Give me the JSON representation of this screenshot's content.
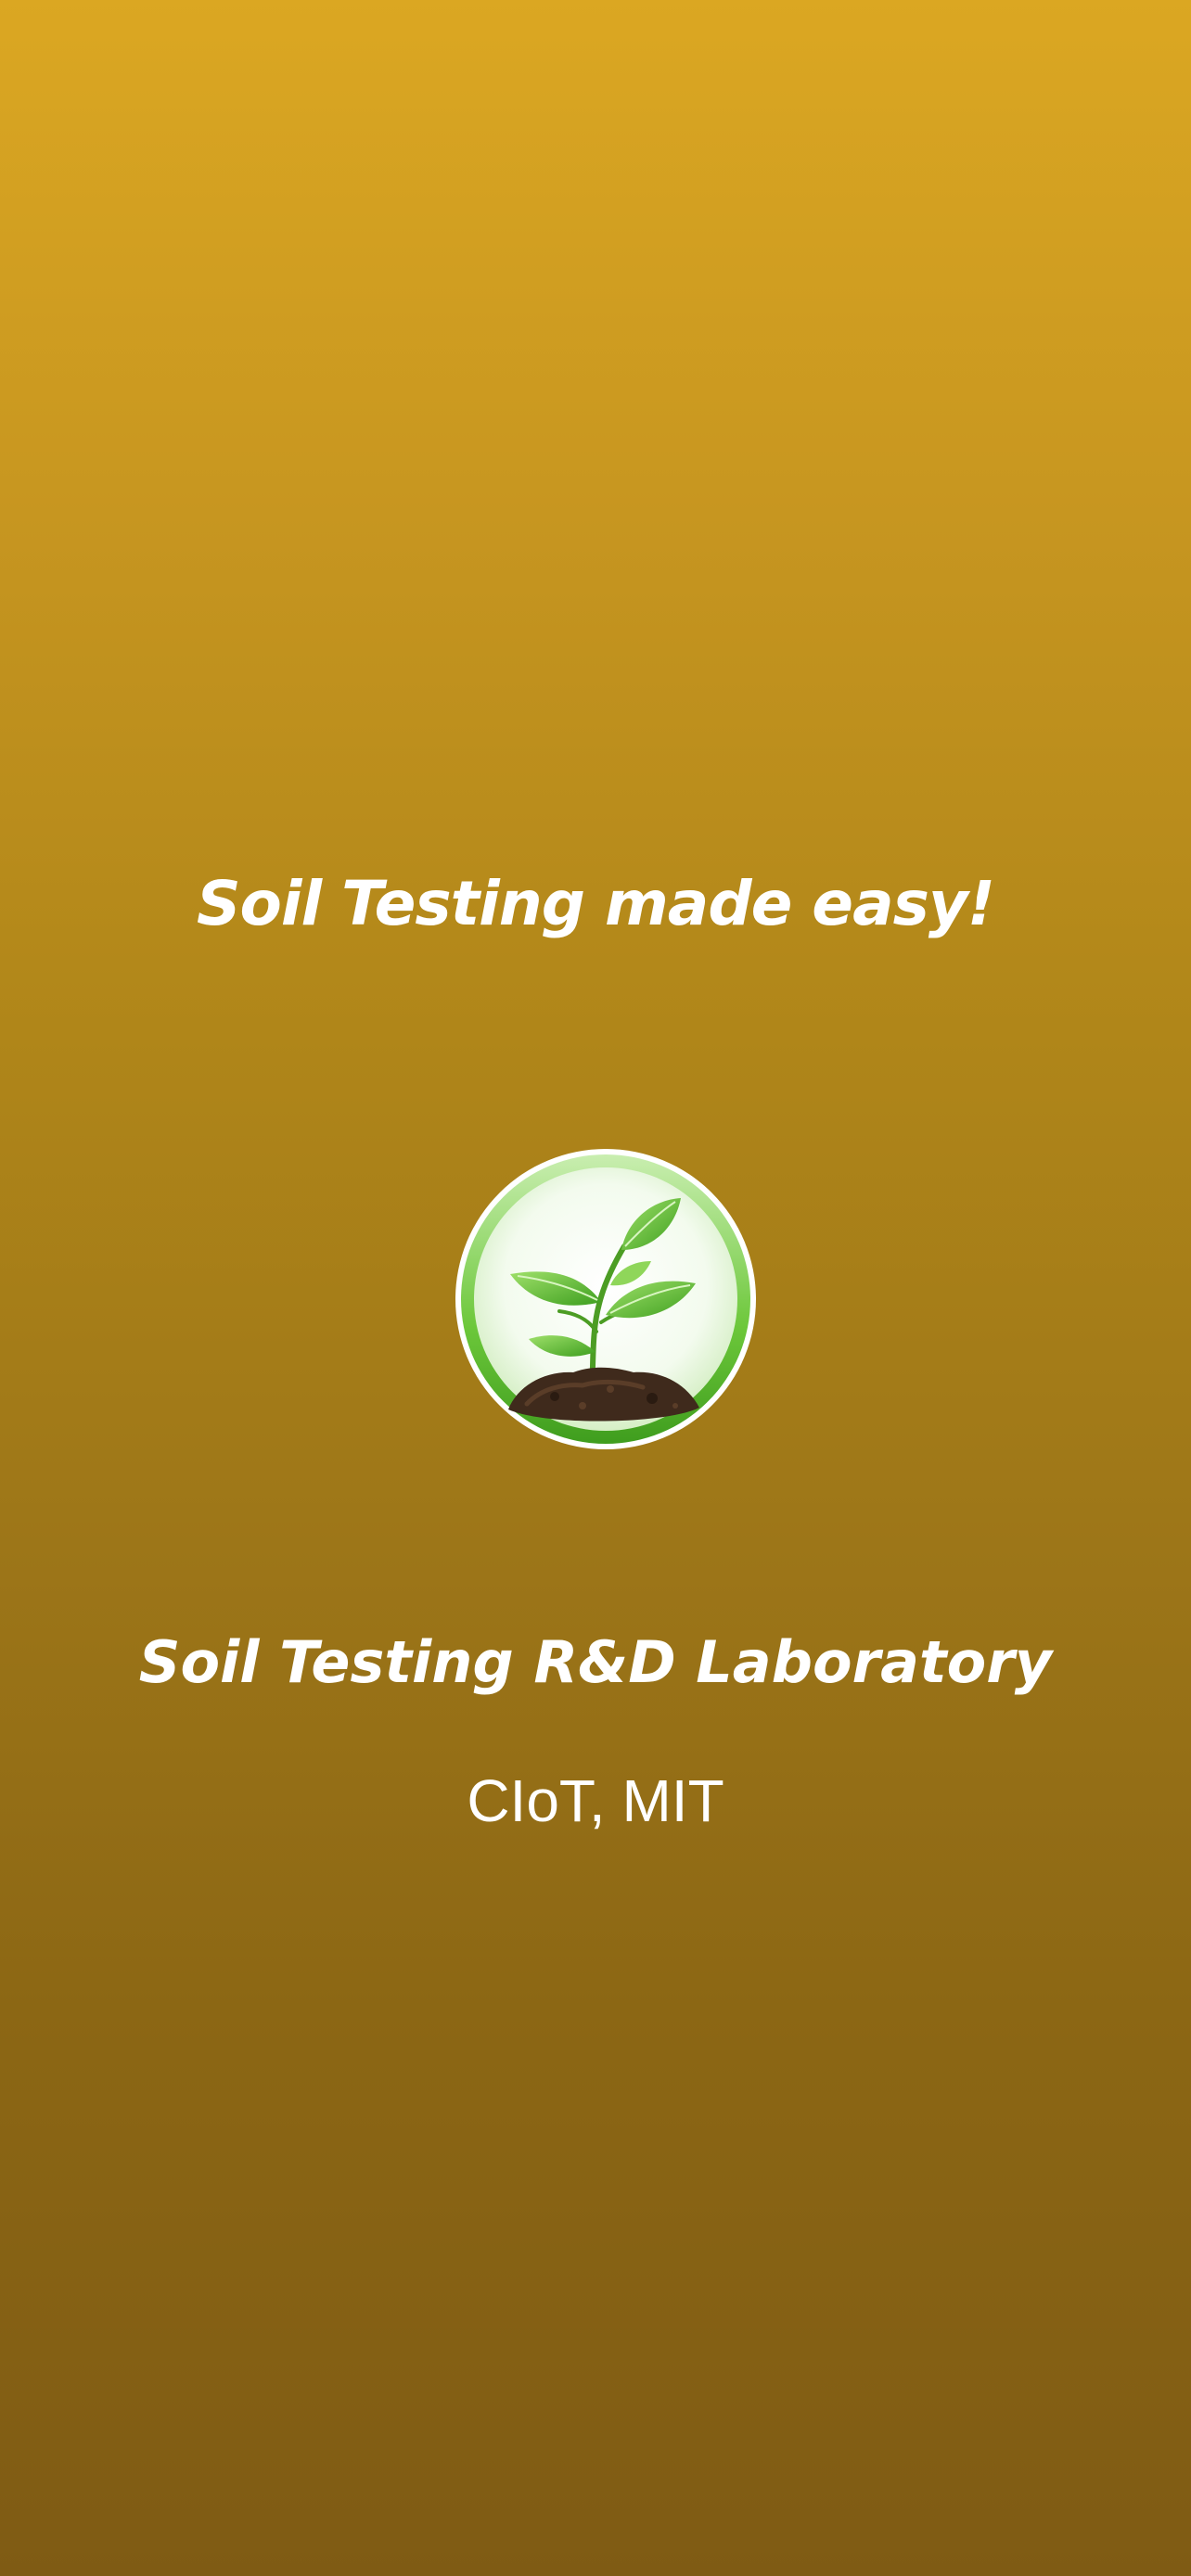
{
  "splash": {
    "tagline": "Soil Testing made easy!",
    "logo_icon": "plant-sprout-in-soil-icon",
    "lab_name": "Soil Testing R&D Laboratory",
    "institute": "CIoT, MIT"
  },
  "colors": {
    "gradient_top": "#dba722",
    "gradient_bottom": "#7f5b14",
    "text": "#ffffff",
    "leaf_green": "#5cbf2a",
    "ring_green": "#6cc73a",
    "soil_brown": "#3f2a1c"
  }
}
